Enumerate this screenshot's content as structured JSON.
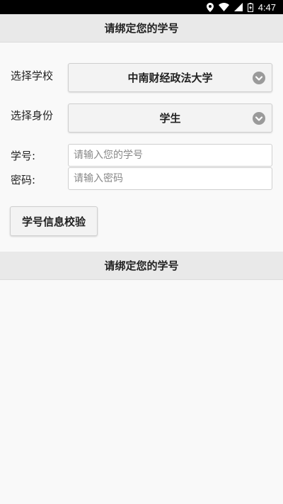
{
  "status_bar": {
    "time": "4:47",
    "icons": [
      "location-icon",
      "wifi-icon",
      "signal-icon",
      "battery-icon"
    ]
  },
  "header": {
    "title": "请绑定您的学号"
  },
  "form": {
    "school": {
      "label": "选择学校",
      "value": "中南财经政法大学"
    },
    "identity": {
      "label": "选择身份",
      "value": "学生"
    },
    "student_id": {
      "label": "学号:",
      "placeholder": "请输入您的学号",
      "value": ""
    },
    "password": {
      "label": "密码:",
      "placeholder": "请输入密码",
      "value": ""
    },
    "verify_button": "学号信息校验"
  },
  "section": {
    "title": "请绑定您的学号"
  },
  "colors": {
    "header_bg": "#e9e9e9",
    "page_bg": "#f9f9f9",
    "status_bar_bg": "#000000",
    "chevron": "#9a9a9a"
  }
}
